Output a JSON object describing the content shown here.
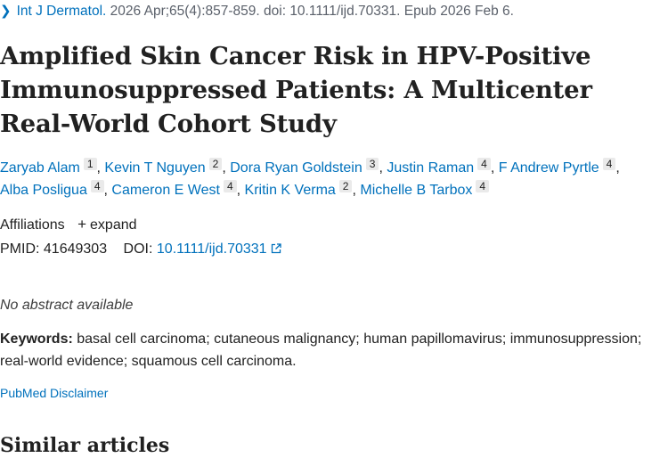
{
  "citation": {
    "journal": "Int J Dermatol.",
    "details": "2026 Apr;65(4):857-859. doi: 10.1111/ijd.70331. Epub 2026 Feb 6."
  },
  "title": "Amplified Skin Cancer Risk in HPV-Positive Immunosuppressed Patients: A Multicenter Real-World Cohort Study",
  "authors": [
    {
      "name": "Zaryab Alam",
      "aff": "1"
    },
    {
      "name": "Kevin T Nguyen",
      "aff": "2"
    },
    {
      "name": "Dora Ryan Goldstein",
      "aff": "3"
    },
    {
      "name": "Justin Raman",
      "aff": "4"
    },
    {
      "name": "F Andrew Pyrtle",
      "aff": "4"
    },
    {
      "name": "Alba Posligua",
      "aff": "4"
    },
    {
      "name": "Cameron E West",
      "aff": "4"
    },
    {
      "name": "Kritin K Verma",
      "aff": "2"
    },
    {
      "name": "Michelle B Tarbox",
      "aff": "4"
    }
  ],
  "affiliations": {
    "label": "Affiliations",
    "expand_label": "expand"
  },
  "ids": {
    "pmid_label": "PMID:",
    "pmid": "41649303",
    "doi_label": "DOI:",
    "doi": "10.1111/ijd.70331"
  },
  "abstract": {
    "text": "No abstract available"
  },
  "keywords": {
    "label": "Keywords:",
    "text": "basal cell carcinoma; cutaneous malignancy; human papillomavirus; immunosuppression; real-world evidence; squamous cell carcinoma."
  },
  "disclaimer": "PubMed Disclaimer",
  "similar_heading": "Similar articles",
  "icons": {
    "citation": "chevron-right-icon",
    "expand": "plus-icon",
    "doi": "external-link-icon"
  },
  "colors": {
    "link": "#0071bc",
    "text": "#212121",
    "muted": "#5b616b",
    "aff_badge": "#eaeaea"
  }
}
